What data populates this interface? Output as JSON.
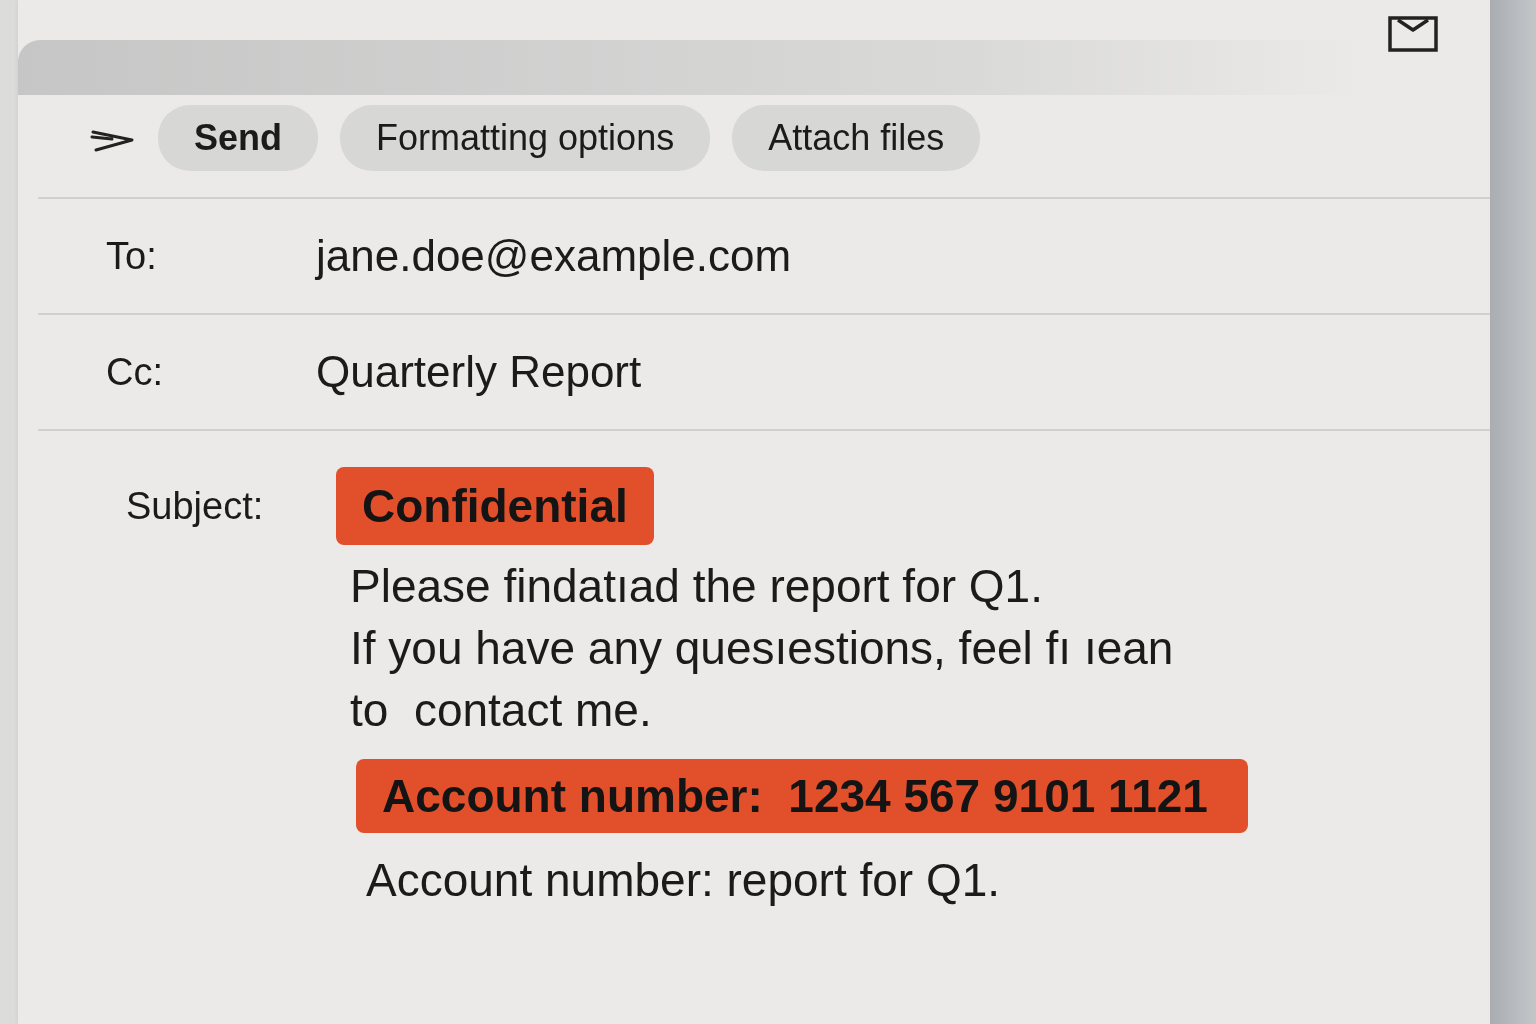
{
  "toolbar": {
    "buttons": [
      {
        "label": "Send",
        "kind": "primary"
      },
      {
        "label": "Formatting options",
        "kind": "secondary"
      },
      {
        "label": "Attach files",
        "kind": "secondary"
      }
    ]
  },
  "fields": [
    {
      "label": "To:",
      "value": "jane.doe@example.com"
    },
    {
      "label": "Cc:",
      "value": "Quarterly Report"
    }
  ],
  "subject": {
    "label": "Subject:"
  },
  "body": [
    {
      "kind": "highlight",
      "text": "Confidential"
    },
    {
      "kind": "paragraph",
      "lines": [
        "Please findatıad the report for Q1.",
        "If you have any quesıestions, feel fı ıean",
        "to  contact me."
      ]
    },
    {
      "kind": "banner",
      "text": "Account number:  1234 567 9101 1121"
    },
    {
      "kind": "paragraph",
      "lines": [
        "Account number: report for Q1."
      ]
    }
  ]
}
